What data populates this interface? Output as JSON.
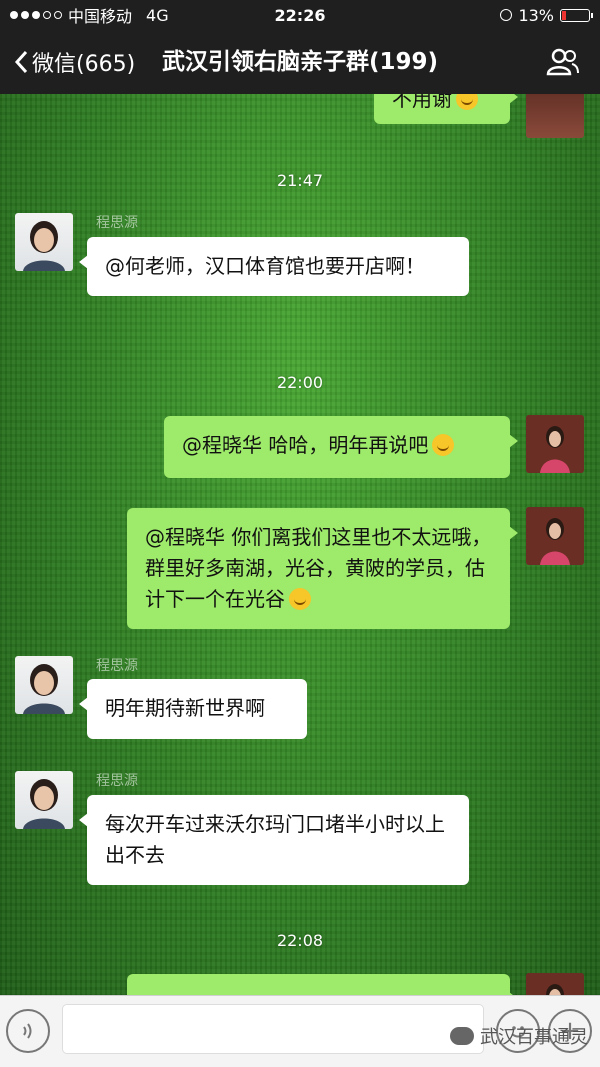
{
  "status_bar": {
    "carrier": "中国移动",
    "network": "4G",
    "time": "22:26",
    "battery": "13%",
    "battery_level_fraction": 0.13
  },
  "nav": {
    "back_label": "微信(665)",
    "title": "武汉引领右脑亲子群(199)",
    "people_icon": "group-members-icon"
  },
  "chat": {
    "top_partial_message": "不用谢",
    "timestamps": [
      "21:47",
      "22:00",
      "22:08"
    ],
    "messages": [
      {
        "sender": "程思源",
        "side": "left",
        "text": "@何老师，汉口体育馆也要开店啊！"
      },
      {
        "sender": "",
        "side": "right",
        "text": "@程晓华 哈哈，明年再说吧"
      },
      {
        "sender": "",
        "side": "right",
        "text": "@程晓华 你们离我们这里也不太远哦，群里好多南湖，光谷，黄陂的学员，估计下一个在光谷"
      },
      {
        "sender": "程思源",
        "side": "left",
        "text": "明年期待新世界啊"
      },
      {
        "sender": "程思源",
        "side": "left",
        "text": "每次开车过来沃尔玛门口堵半小时以上出不去"
      }
    ]
  },
  "input_bar": {
    "voice_icon": "voice-icon",
    "emoji_icon": "emoji-icon",
    "plus_icon": "plus-icon"
  },
  "watermark": "武汉百事通灵",
  "colors": {
    "green_bubble": "#9eea6a",
    "white_bubble": "#ffffff",
    "bar_dark": "#1f1f1f"
  }
}
